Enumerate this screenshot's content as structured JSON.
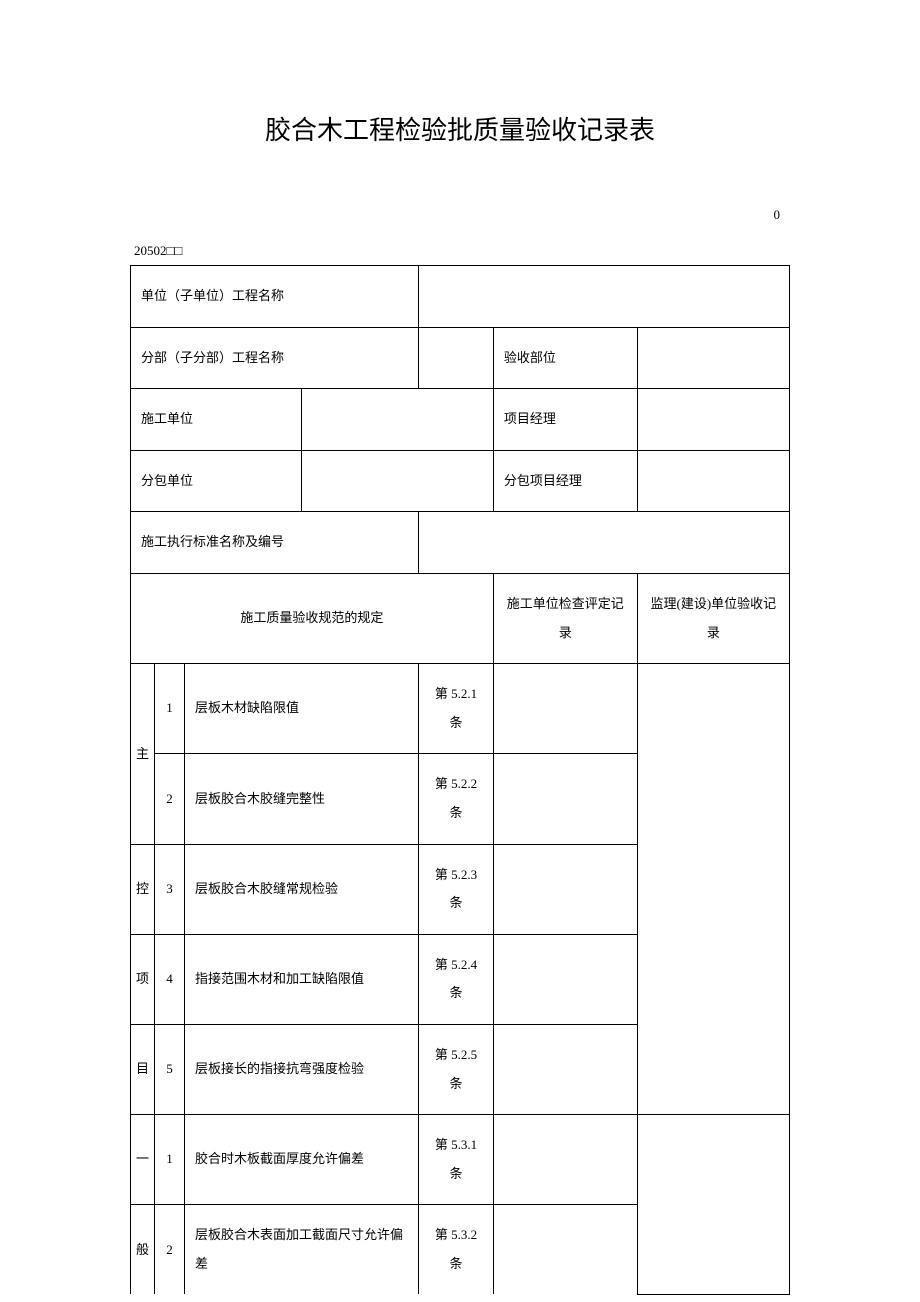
{
  "title": "胶合木工程检验批质量验收记录表",
  "topRight": "0",
  "formCode": "20502□□",
  "header": {
    "row1_label": "单位（子单位）工程名称",
    "row2_label": "分部（子分部）工程名称",
    "row2_right_label": "验收部位",
    "row3_label": "施工单位",
    "row3_right_label": "项目经理",
    "row4_label": "分包单位",
    "row4_right_label": "分包项目经理",
    "row5_label": "施工执行标准名称及编号"
  },
  "columns": {
    "spec": "施工质量验收规范的规定",
    "check": "施工单位检查评定记录",
    "accept": "监理(建设)单位验收记录"
  },
  "groups": {
    "main": {
      "char1": "主",
      "char2": "控",
      "char3": "项",
      "char4": "目",
      "items": [
        {
          "num": "1",
          "desc": "层板木材缺陷限值",
          "clause": "第 5.2.1 条"
        },
        {
          "num": "2",
          "desc": "层板胶合木胶缝完整性",
          "clause": "第 5.2.2 条"
        },
        {
          "num": "3",
          "desc": "层板胶合木胶缝常规检验",
          "clause": "第 5.2.3 条"
        },
        {
          "num": "4",
          "desc": "指接范围木材和加工缺陷限值",
          "clause": "第 5.2.4 条"
        },
        {
          "num": "5",
          "desc": "层板接长的指接抗弯强度检验",
          "clause": "第 5.2.5 条"
        }
      ]
    },
    "general": {
      "char1": "一",
      "char2": "般",
      "items": [
        {
          "num": "1",
          "desc": "胶合时木板截面厚度允许偏差",
          "clause": "第 5.3.1 条"
        },
        {
          "num": "2",
          "desc": "层板胶合木表面加工截面尺寸允许偏差",
          "clause": "第 5.3.2 条"
        }
      ]
    }
  }
}
